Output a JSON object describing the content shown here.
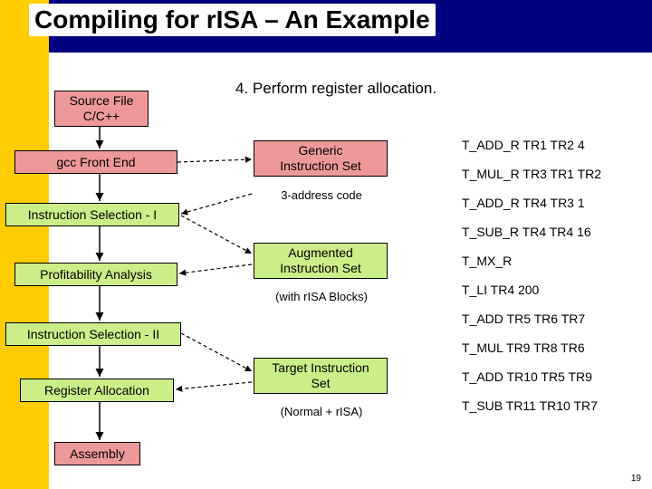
{
  "title": "Compiling for rISA – An Example",
  "caption": "4. Perform register allocation.",
  "left_boxes": {
    "source": {
      "l1": "Source File",
      "l2": "C/C++"
    },
    "gcc": "gcc Front End",
    "isel1": "Instruction Selection - I",
    "profit": "Profitability Analysis",
    "isel2": "Instruction Selection - II",
    "regalloc": "Register Allocation",
    "assembly": "Assembly"
  },
  "mid_boxes": {
    "generic": {
      "l1": "Generic",
      "l2": "Instruction Set",
      "sub": "3-address code"
    },
    "augmented": {
      "l1": "Augmented",
      "l2": "Instruction Set",
      "sub": "(with rISA Blocks)"
    },
    "target": {
      "l1": "Target Instruction",
      "l2": "Set",
      "sub": "(Normal + rISA)"
    }
  },
  "instructions": [
    "T_ADD_R TR1 TR2 4",
    "T_MUL_R TR3 TR1 TR2",
    "T_ADD_R TR4 TR3 1",
    "T_SUB_R TR4 TR4 16",
    "T_MX_R",
    "T_LI TR4 200",
    "T_ADD TR5 TR6 TR7",
    "T_MUL TR9 TR8 TR6",
    "T_ADD TR10 TR5 TR9",
    "T_SUB TR11 TR10 TR7"
  ],
  "slide_number": "19"
}
